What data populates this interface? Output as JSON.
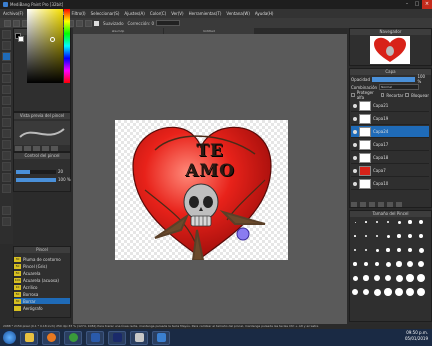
{
  "window": {
    "title": "MediBang Paint Pro [32bit]"
  },
  "menu": [
    "Archivo(F)",
    "Editar(E)",
    "Capa(L)",
    "Filtro(I)",
    "Seleccionar(S)",
    "Ajustes(A)",
    "Color(C)",
    "Ver(V)",
    "Herramientas(T)",
    "Ventana(W)",
    "Ayuda(H)"
  ],
  "toolbar": {
    "antialias_label": "Suavizado",
    "correction_label": "Corrección: 0"
  },
  "tabs": [
    "ata.mdp",
    "Untitled"
  ],
  "panels": {
    "color": "Color",
    "brush": "Vista previa del pincel",
    "control": "Control del pincel",
    "control_values": [
      "20",
      "100 %"
    ],
    "pencil": "Pincel",
    "navigator": "Navegador",
    "layer": "Capa",
    "size": "Tamaño del Pincel"
  },
  "brushes": [
    {
      "size": "30",
      "name": "Pluma de contorno"
    },
    {
      "size": "50",
      "name": "Pincel (Gris)"
    },
    {
      "size": "50",
      "name": "Acuarela"
    },
    {
      "size": "100",
      "name": "Acuarela (acuosa)"
    },
    {
      "size": "10",
      "name": "Acrílico"
    },
    {
      "size": "50",
      "name": "Borrosa"
    },
    {
      "size": "30",
      "name": "Borrar"
    },
    {
      "size": "",
      "name": "Aerógrafo"
    }
  ],
  "selected_brush_index": 6,
  "layer_panel": {
    "opacity_label": "Opacidad",
    "opacity_value": "100 %",
    "blend_label": "Combinación",
    "blend_value": "Normal",
    "protect_alpha": "Proteger alfa",
    "clipping": "Recortar",
    "reference": "Bloquear"
  },
  "layers": [
    "Capa21",
    "Capa19",
    "Capa24",
    "Capa17",
    "Capa18",
    "Capa7",
    "Capa10"
  ],
  "selected_layer_index": 2,
  "canvas_text": "TE AMO",
  "status_text": "2988 * 2150 pixel   (0.1 * 0.18 inch)   250 dpi   33 %   (1274, 1082)   Para trazar una línea recta, mantenga pulsada la tecla Mayús. Para cambiar el tamaño del pincel, mantenga pulsada las teclas Ctrl + Alt y arrastre",
  "clock": {
    "time": "09:50 p.m.",
    "date": "05/01/2019"
  }
}
